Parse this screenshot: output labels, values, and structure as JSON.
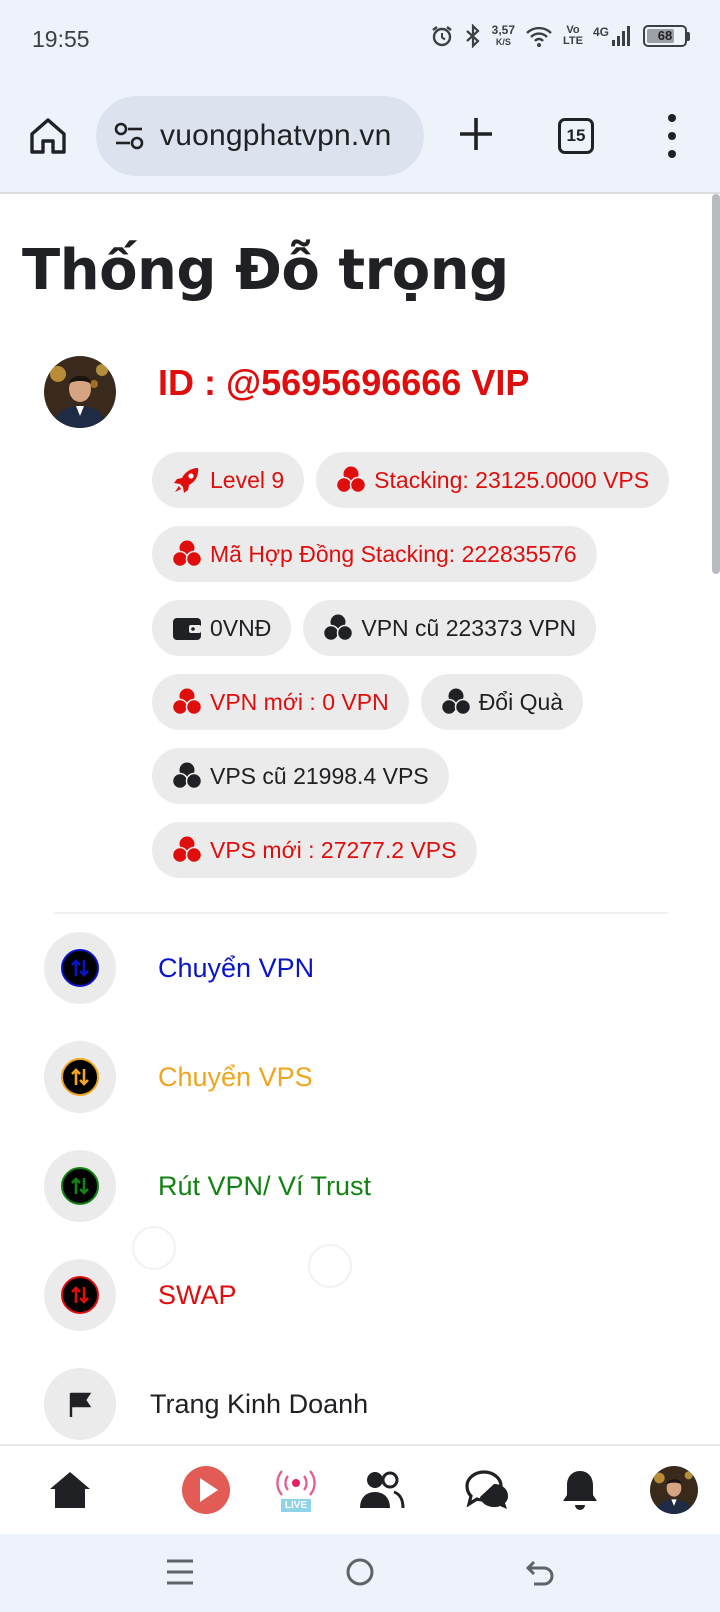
{
  "status_bar": {
    "time": "19:55",
    "net_speed": "3,57",
    "net_unit": "K/S",
    "volte_top": "Vo",
    "volte_bottom": "LTE",
    "network": "4G",
    "battery": "68"
  },
  "browser": {
    "url": "vuongphatvpn.vn",
    "tab_count": "15"
  },
  "page": {
    "title": "Thống Đỗ trọng",
    "user_id": "ID : @5695696666 VIP",
    "chips": {
      "level": "Level 9",
      "stacking": "Stacking: 23125.0000 VPS",
      "contract": "Mã Hợp Đồng Stacking: 222835576",
      "wallet": "0VNĐ",
      "vpn_old": "VPN cũ 223373 VPN",
      "vpn_new": "VPN mới : 0 VPN",
      "gift": "Đổi Quà",
      "vps_old": "VPS cũ 21998.4 VPS",
      "vps_new": "VPS mới : 27277.2 VPS"
    },
    "menu": {
      "transfer_vpn": "Chuyển VPN",
      "transfer_vps": "Chuyển VPS",
      "withdraw": "Rút VPN/ Ví Trust",
      "swap": "SWAP",
      "business": "Trang Kinh Doanh"
    }
  },
  "app_nav": {
    "live_badge": "LIVE"
  },
  "colors": {
    "red": "#e00d0d",
    "blue": "#0a14c8",
    "orange": "#f0a51c",
    "green": "#128312",
    "chip_bg": "#ebebeb",
    "browser_bg": "#eef2fb"
  }
}
